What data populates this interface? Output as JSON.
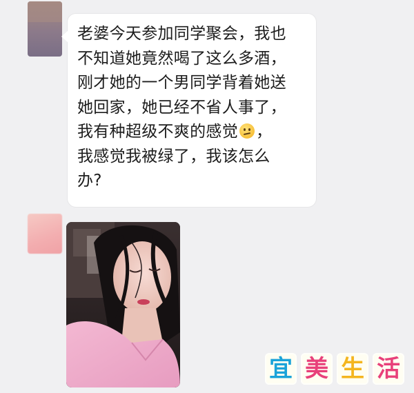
{
  "conversation": {
    "incoming_message": {
      "lines": [
        "老婆今天参加同学聚会，我也",
        "不知道她竟然喝了这么多酒，",
        "刚才她的一个男同学背着她送",
        "她回家，她已经不省人事了，",
        "我有种超级不爽的感觉",
        "，",
        "我感觉我被绿了，我该怎么",
        "办?"
      ],
      "emoji": "confused-face-emoji"
    },
    "image_message": {
      "icon": "photo-woman-asleep"
    }
  },
  "watermark": {
    "chars": [
      "宜",
      "美",
      "生",
      "活"
    ],
    "colors": [
      "#1aa3d9",
      "#e8407a",
      "#f4b51f",
      "#e8407a"
    ]
  }
}
